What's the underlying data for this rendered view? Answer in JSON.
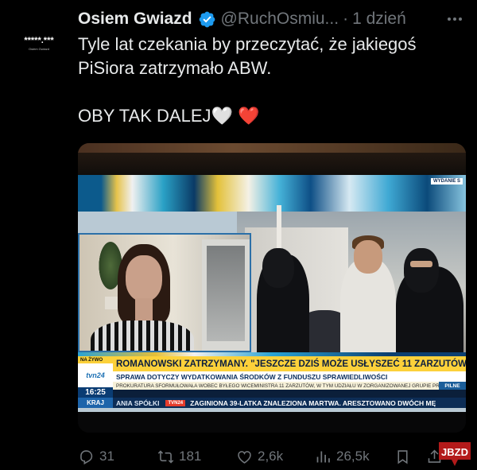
{
  "colors": {
    "background": "#000000",
    "text": "#e7e9ea",
    "muted": "#71767b",
    "verified": "#1d9bf0",
    "heart_red": "#e0245e"
  },
  "avatar": {
    "stars": "*****.***",
    "caption": "Osiem Gwiazd"
  },
  "author": {
    "name": "Osiem Gwiazd",
    "handle": "@RuchOsmiu...",
    "separator": "·",
    "time": "1 dzień",
    "verified_icon": "verified-badge-icon",
    "more_icon": "more-icon"
  },
  "tweet": {
    "line1": "Tyle lat czekania by przeczytać, że jakiegoś",
    "line2": "PiSiora zatrzymało ABW.",
    "line3": "OBY TAK DALEJ",
    "emoji_white_heart": "🤍",
    "emoji_red_heart": "❤️"
  },
  "media": {
    "top_badge": "WYDANIE S",
    "live_label": "NA ŻYWO",
    "channel_logo": "tvn24",
    "clock": "16:25",
    "section": "KRAJ",
    "headline": "ROMANOWSKI ZATRZYMANY. \"JESZCZE DZIŚ MOŻE USŁYSZEĆ 11 ZARZUTÓW\"",
    "subheadline": "SPRAWA DOTYCZY WYDATKOWANIA ŚRODKÓW Z FUNDUSZU SPRAWIEDLIWOŚCI",
    "info_line": "PROKURATURA SFORMUŁOWAŁA WOBEC BYŁEGO WICEMINISTRA 11 ZARZUTÓW, W TYM UDZIAŁU W ZORGANIZOWANEJ GRUPIE PRZESTĘPCZEJ",
    "urgent": "PILNE",
    "ticker_left": "ANIA SPÓŁKI",
    "ticker_badge": "TVN24",
    "ticker_right": "ZAGINIONA 39-LATKA ZNALEZIONA MARTWA. ARESZTOWANO DWÓCH MĘ"
  },
  "actions": {
    "replies": "31",
    "reposts": "181",
    "likes": "2,6k",
    "views": "26,5k",
    "reply_icon": "reply-icon",
    "repost_icon": "repost-icon",
    "like_icon": "like-icon",
    "views_icon": "views-icon",
    "bookmark_icon": "bookmark-icon",
    "share_icon": "share-icon"
  },
  "watermark": {
    "text": "JBZD"
  }
}
